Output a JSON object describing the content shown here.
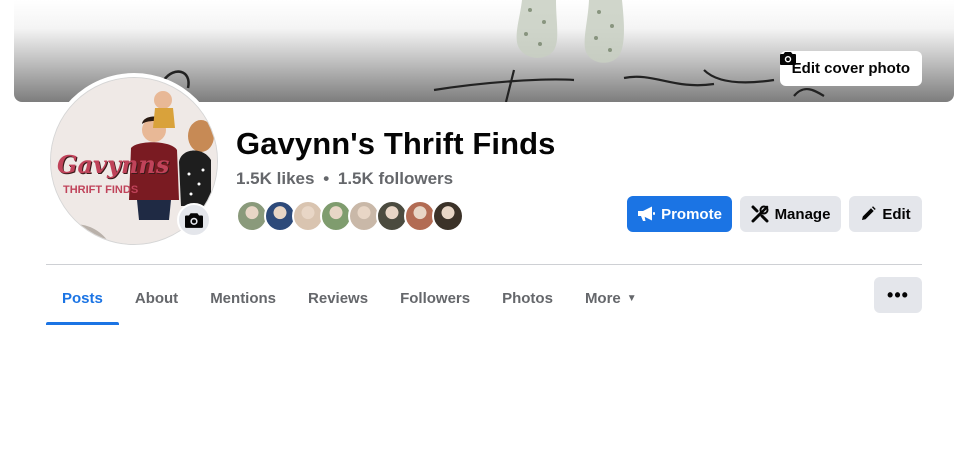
{
  "cover": {
    "edit_label": "Edit cover photo",
    "icons": [
      "camera-icon"
    ]
  },
  "page": {
    "title": "Gavynn's Thrift Finds",
    "likes": "1.5K likes",
    "separator": "•",
    "followers": "1.5K followers"
  },
  "avatar": {
    "logo_line1": "Gavynns",
    "logo_line2": "THRIFT FINDS",
    "camera_icon": "camera-icon"
  },
  "friends": [
    {
      "color": "#8a9a7b"
    },
    {
      "color": "#2d4a7a"
    },
    {
      "color": "#d9c4b0"
    },
    {
      "color": "#7f9c6e"
    },
    {
      "color": "#c9b8a8"
    },
    {
      "color": "#4b4b3f"
    },
    {
      "color": "#b26b53"
    },
    {
      "color": "#3b3228"
    }
  ],
  "actions": {
    "promote_label": "Promote",
    "manage_label": "Manage",
    "edit_label": "Edit"
  },
  "tabs": [
    {
      "label": "Posts",
      "active": true
    },
    {
      "label": "About"
    },
    {
      "label": "Mentions"
    },
    {
      "label": "Reviews"
    },
    {
      "label": "Followers"
    },
    {
      "label": "Photos"
    },
    {
      "label": "More"
    }
  ],
  "overflow": {
    "label": "•••"
  },
  "colors": {
    "accent": "#1b74e4",
    "secondary_button": "#e4e6eb",
    "muted_text": "#65676b"
  }
}
